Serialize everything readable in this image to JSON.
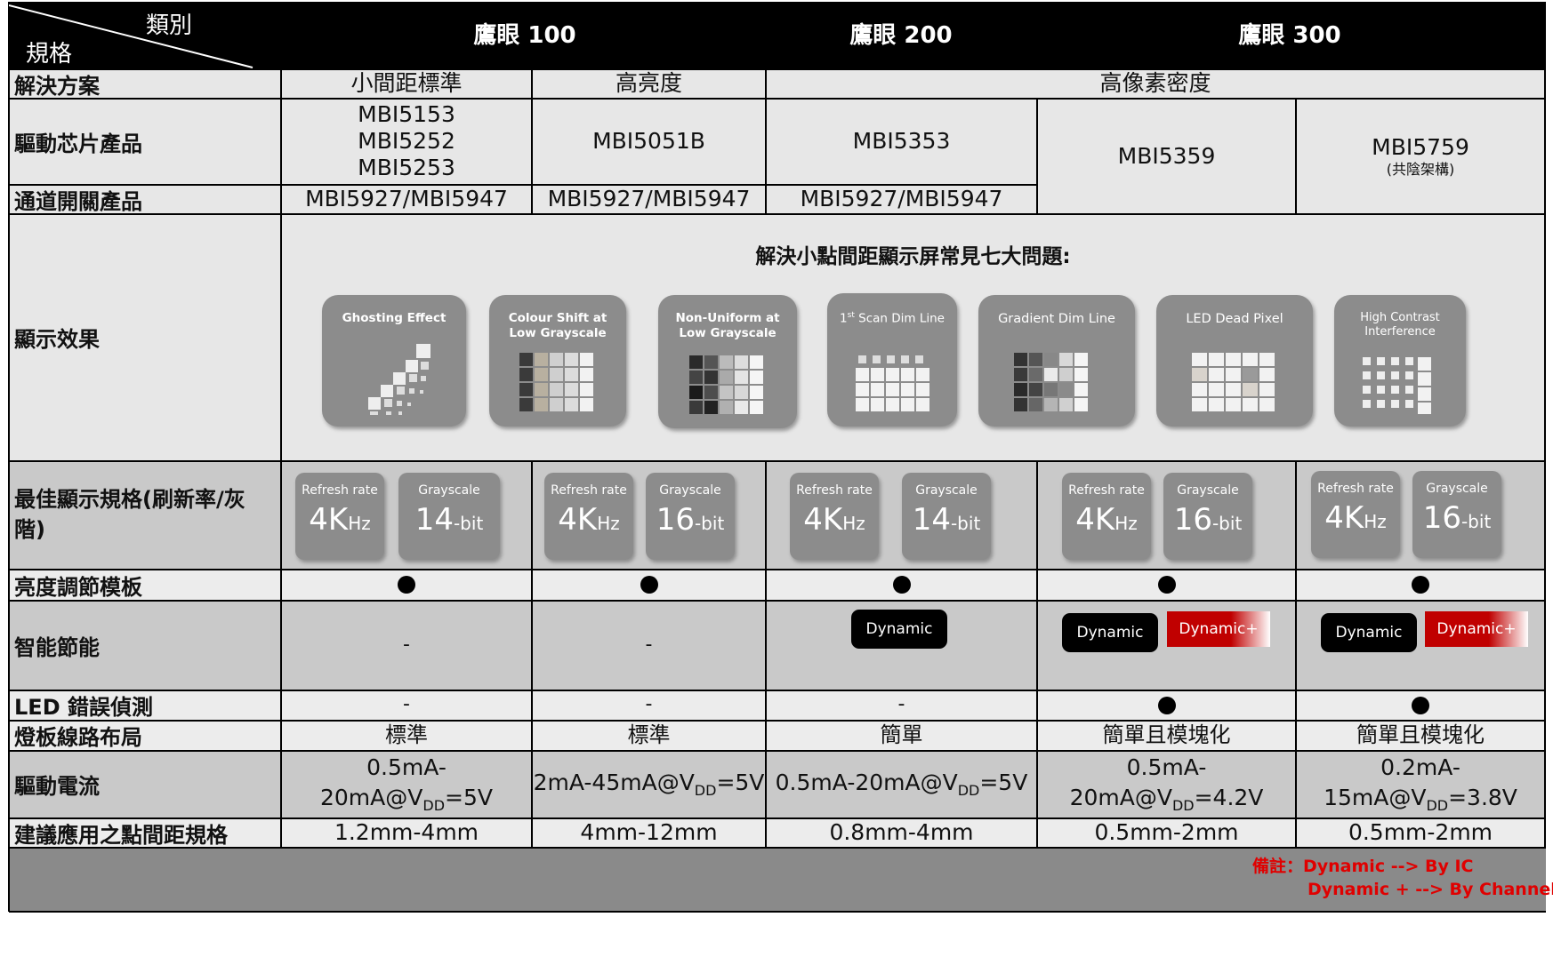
{
  "header": {
    "category_label": "類別",
    "spec_label": "規格",
    "col_100": "鷹眼 100",
    "col_200": "鷹眼 200",
    "col_300": "鷹眼 300"
  },
  "rows": {
    "solution": "解決方案",
    "driver_ic": "驅動芯片產品",
    "switch": "通道開關產品",
    "display_effect": "顯示效果",
    "best_spec": "最佳顯示規格(刷新率/灰階)",
    "brightness": "亮度調節模板",
    "smart_power": "智能節能",
    "led_detect": "LED 錯誤偵測",
    "layout": "燈板線路布局",
    "current": "驅動電流",
    "pitch": "建議應用之點間距規格"
  },
  "solution": {
    "c1": "小間距標準",
    "c2": "高亮度",
    "c3": "高像素密度"
  },
  "driver": {
    "c1": [
      "MBI5153",
      "MBI5252",
      "MBI5253"
    ],
    "c2": "MBI5051B",
    "c3": "MBI5353",
    "c4": "MBI5359",
    "c5": "MBI5759",
    "c5_note": "(共陰架構)"
  },
  "switch": {
    "c1": "MBI5927/MBI5947",
    "c2": "MBI5927/MBI5947",
    "c3": "MBI5927/MBI5947"
  },
  "display_effect": {
    "title": "解決小點間距顯示屏常見七大問題:",
    "tiles": [
      {
        "label": "Ghosting Effect",
        "icon": "ghosting-icon"
      },
      {
        "label": "Colour Shift at Low Grayscale",
        "icon": "colour-shift-icon"
      },
      {
        "label": "Non-Uniform at Low Grayscale",
        "icon": "non-uniform-icon"
      },
      {
        "label": "1st Scan Dim Line",
        "label_sup": "st",
        "label_pre": "1",
        "label_post": " Scan Dim Line",
        "icon": "scan-dim-line-icon"
      },
      {
        "label": "Gradient Dim Line",
        "icon": "gradient-dim-line-icon"
      },
      {
        "label": "LED Dead Pixel",
        "icon": "dead-pixel-icon"
      },
      {
        "label": "High Contrast Interference",
        "icon": "high-contrast-icon"
      }
    ]
  },
  "best_spec": {
    "refresh_label": "Refresh rate",
    "grayscale_label": "Grayscale",
    "refresh_value": "4K",
    "refresh_unit": "Hz",
    "bit_unit": "-bit",
    "grayscale_values": [
      "14",
      "16",
      "14",
      "16",
      "16"
    ]
  },
  "brightness": {
    "symbol": "●"
  },
  "smart_power": {
    "c1": "-",
    "c2": "-",
    "dynamic": "Dynamic",
    "dynamic_plus": "Dynamic+"
  },
  "led_detect": {
    "c1": "-",
    "c2": "-",
    "c3": "-"
  },
  "layout": {
    "c1": "標準",
    "c2": "標準",
    "c3": "簡單",
    "c4": "簡單且模塊化",
    "c5": "簡單且模塊化"
  },
  "current": {
    "c1_a": "0.5mA-",
    "c1_b": "20mA@V",
    "c1_c": "=5V",
    "c2_a": "2mA-45mA@V",
    "c2_c": "=5V",
    "c3_a": "0.5mA-20mA@V",
    "c3_c": "=5V",
    "c4_a": "0.5mA-",
    "c4_b": "20mA@V",
    "c4_c": "=4.2V",
    "c5_a": "0.2mA-",
    "c5_b": "15mA@V",
    "c5_c": "=3.8V",
    "sub": "DD"
  },
  "pitch": {
    "c1": "1.2mm-4mm",
    "c2": "4mm-12mm",
    "c3": "0.8mm-4mm",
    "c4": "0.5mm-2mm",
    "c5": "0.5mm-2mm"
  },
  "footnote": {
    "line1": "備註：Dynamic --> By IC",
    "line2": "Dynamic + --> By Channel",
    "color": "#e00000"
  },
  "colors": {
    "header_bg": "#000000",
    "light_row": "#e7e7e7",
    "mid_row": "#c9c9c9",
    "tile": "#8c8c8c",
    "red_badge": "#c00000"
  }
}
